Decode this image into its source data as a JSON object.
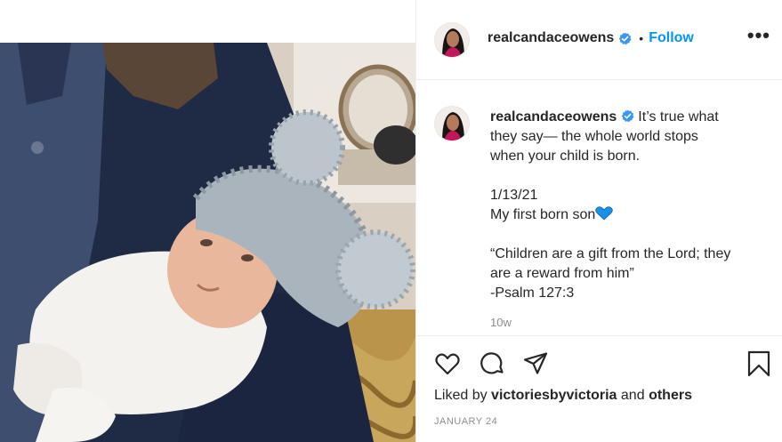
{
  "post": {
    "username": "realcandaceowens",
    "verified": true,
    "follow_label": "Follow",
    "separator": "•",
    "more_label": "•••",
    "caption": {
      "line1": "It’s true what",
      "line2": "they say— the whole world stops",
      "line3": "when your child is born.",
      "date_line": "1/13/21",
      "son_line": "My first born son",
      "quote_line1": "“Children are a gift from the Lord; they",
      "quote_line2": "are a reward from him”",
      "quote_ref": "-Psalm 127:3"
    },
    "timestamp": "10w",
    "liked_by_prefix": "Liked by",
    "liked_by_user": "victoriesbyvictoria",
    "liked_by_and": "and",
    "liked_by_others": "others",
    "date": "JANUARY 24"
  },
  "icons": {
    "verified": "verified-badge-icon",
    "like": "heart-outline-icon",
    "comment": "comment-bubble-icon",
    "share": "paper-plane-icon",
    "save": "bookmark-icon",
    "more": "more-options-icon",
    "heart_emoji": "blue-heart-emoji"
  },
  "colors": {
    "accent": "#0095f6",
    "verified": "#3897f0",
    "muted": "#8e8e8e",
    "text": "#262626",
    "heart_emoji": "#1a8fe3"
  }
}
